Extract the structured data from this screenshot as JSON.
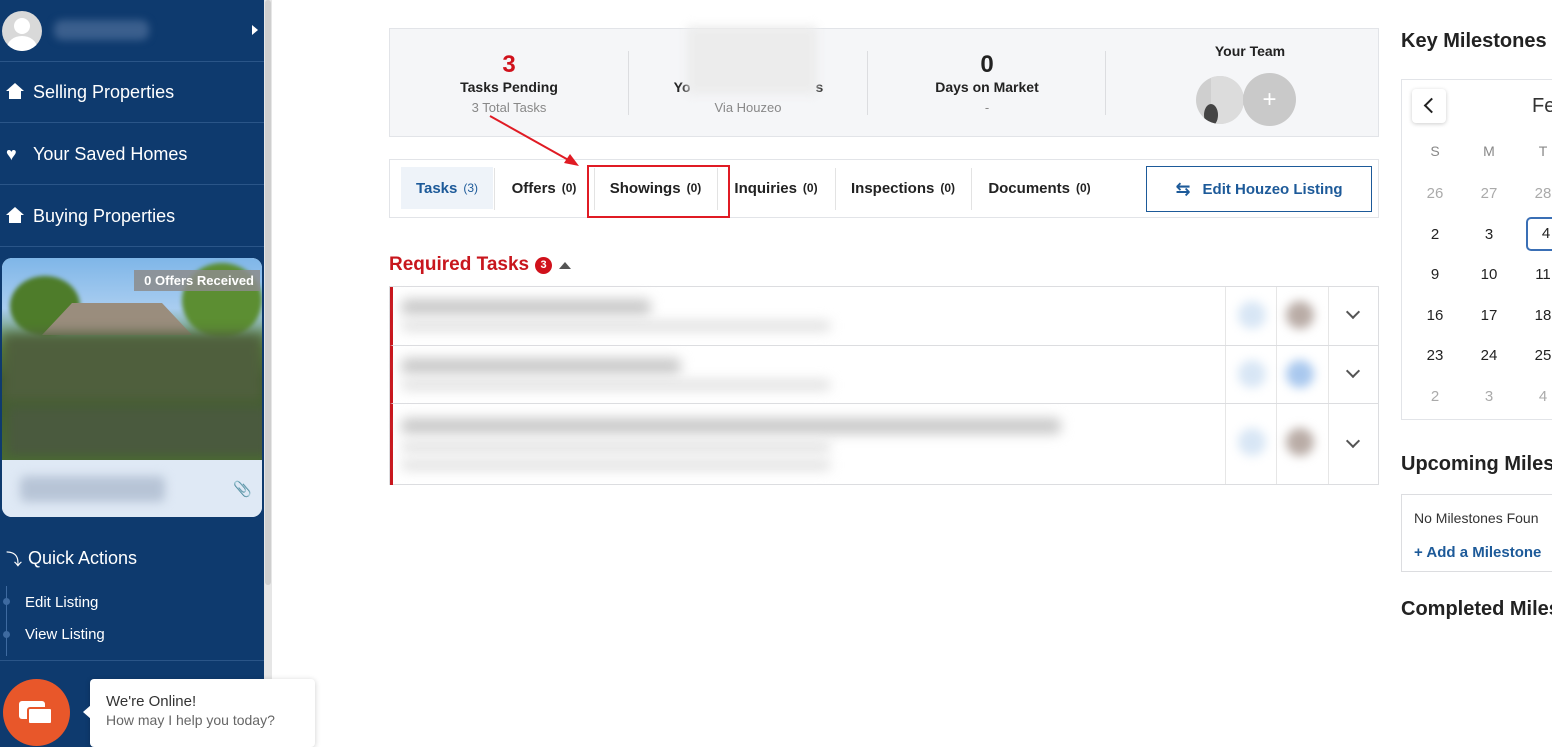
{
  "sidebar": {
    "items": [
      {
        "label": "Selling Properties",
        "icon": "home-icon"
      },
      {
        "label": "Your Saved Homes",
        "icon": "heart-icon"
      },
      {
        "label": "Buying Properties",
        "icon": "home-icon"
      }
    ],
    "property_card": {
      "offers_badge": "0 Offers Received"
    },
    "quick_actions": {
      "title": "Quick Actions",
      "links": [
        "Edit Listing",
        "View Listing"
      ]
    }
  },
  "chat": {
    "line1": "We're Online!",
    "line2": "How may I help you today?"
  },
  "stats": {
    "tasks_pending": {
      "value": "3",
      "label": "Tasks Pending",
      "sub": "3 Total Tasks"
    },
    "second": {
      "label_start": "Yo",
      "label_end": "s",
      "sub": "Via Houzeo"
    },
    "days_on_market": {
      "value": "0",
      "label": "Days on Market",
      "sub": "-"
    },
    "team": {
      "label": "Your Team",
      "add": "+"
    }
  },
  "tabs": [
    {
      "label": "Tasks",
      "count": "(3)"
    },
    {
      "label": "Offers",
      "count": "(0)"
    },
    {
      "label": "Showings",
      "count": "(0)"
    },
    {
      "label": "Inquiries",
      "count": "(0)"
    },
    {
      "label": "Inspections",
      "count": "(0)"
    },
    {
      "label": "Documents",
      "count": "(0)"
    }
  ],
  "edit_button": {
    "label": "Edit Houzeo Listing",
    "icon": "swap-icon"
  },
  "required_tasks": {
    "title": "Required Tasks",
    "count": "3"
  },
  "key_milestones": {
    "title": "Key Milestones",
    "month": "Fe",
    "dow": [
      "S",
      "M",
      "T"
    ],
    "weeks": [
      [
        "26",
        "27",
        "28"
      ],
      [
        "2",
        "3",
        "4"
      ],
      [
        "9",
        "10",
        "11"
      ],
      [
        "16",
        "17",
        "18"
      ],
      [
        "23",
        "24",
        "25"
      ],
      [
        "2",
        "3",
        "4"
      ]
    ]
  },
  "upcoming": {
    "title": "Upcoming Milest",
    "none": "No Milestones Foun",
    "add": "+ Add a Milestone"
  },
  "completed": {
    "title": "Completed Miles"
  },
  "colors": {
    "sidebar": "#0e3a6e",
    "accent_red": "#d0111b",
    "accent_blue": "#1d5a99",
    "chat_orange": "#e8572a"
  }
}
